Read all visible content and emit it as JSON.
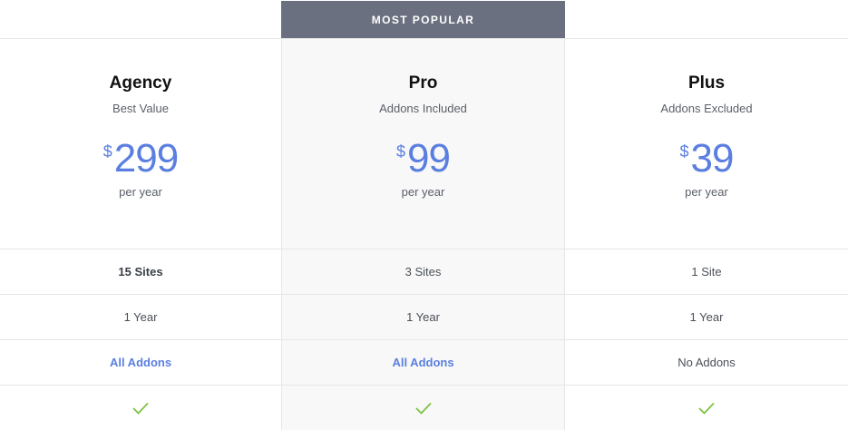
{
  "badge": {
    "label": "MOST POPULAR"
  },
  "plans": [
    {
      "name": "Agency",
      "subtitle": "Best Value",
      "currency": "$",
      "price": "299",
      "period": "per year",
      "sites": "15 Sites",
      "duration": "1 Year",
      "addons": "All Addons",
      "included": true
    },
    {
      "name": "Pro",
      "subtitle": "Addons Included",
      "currency": "$",
      "price": "99",
      "period": "per year",
      "sites": "3 Sites",
      "duration": "1 Year",
      "addons": "All Addons",
      "included": true
    },
    {
      "name": "Plus",
      "subtitle": "Addons Excluded",
      "currency": "$",
      "price": "39",
      "period": "per year",
      "sites": "1 Site",
      "duration": "1 Year",
      "addons": "No Addons",
      "included": true
    }
  ],
  "colors": {
    "accent": "#5b7fe0",
    "badge_bg": "#6b7080",
    "check": "#7dc241",
    "highlight_bg": "#f8f8f8"
  },
  "icons": {
    "included": "checkmark-icon"
  }
}
